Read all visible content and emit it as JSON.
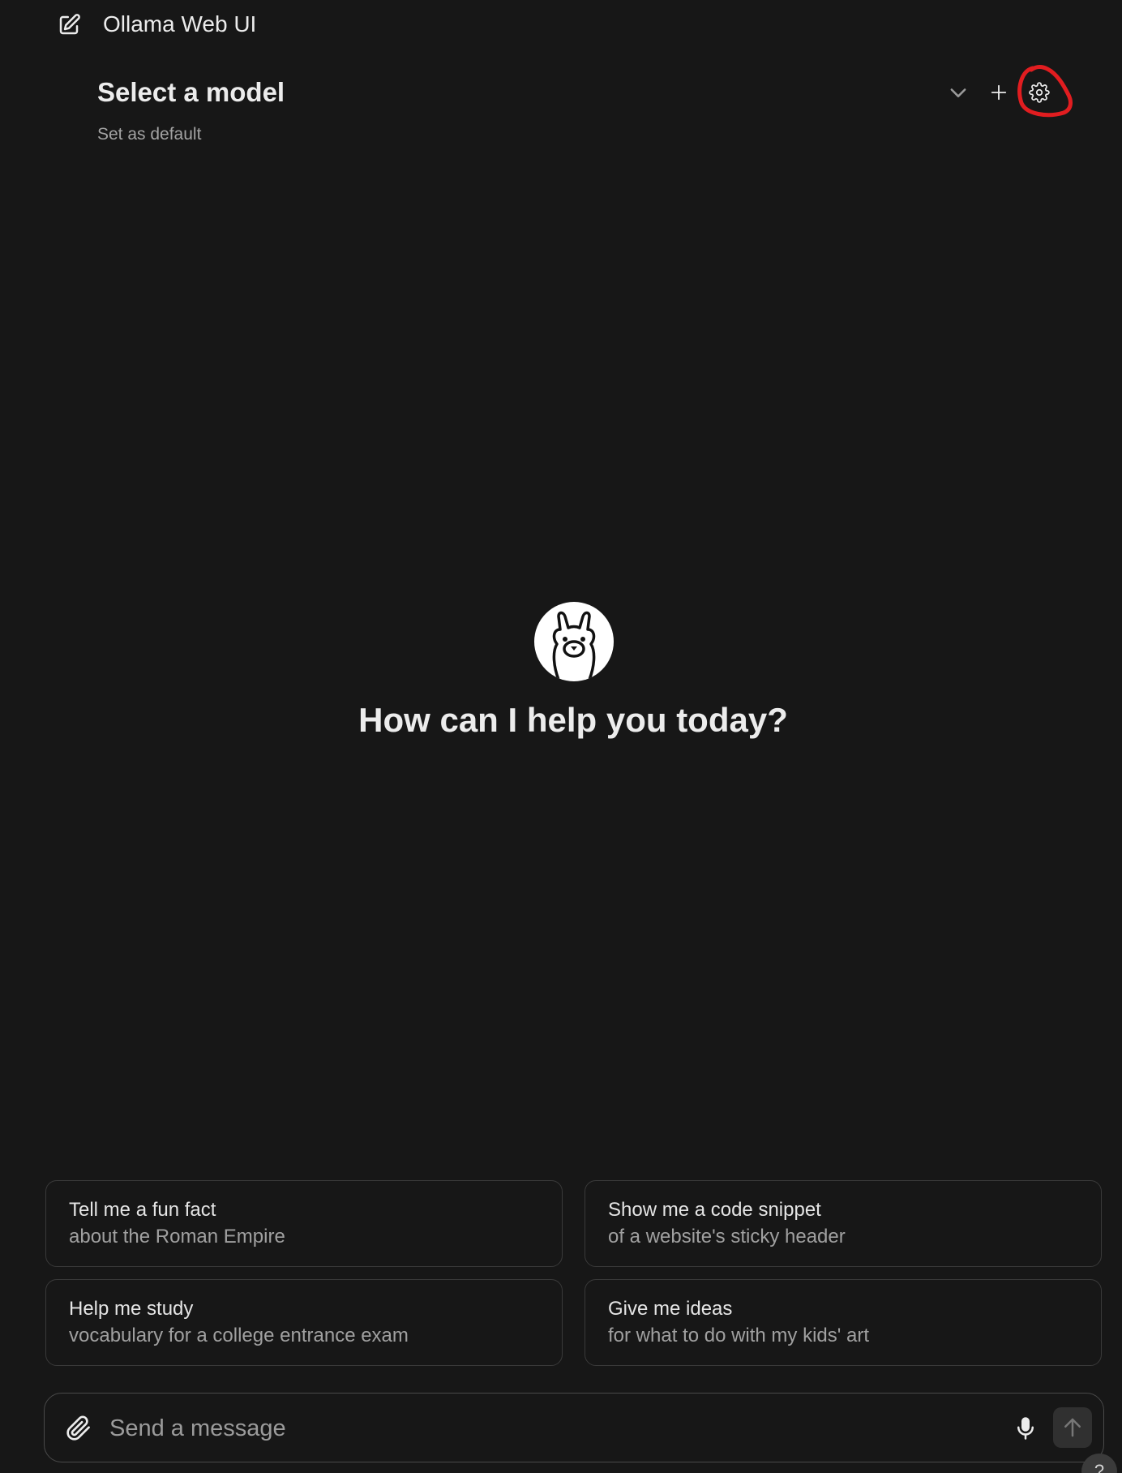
{
  "header": {
    "title": "Ollama Web UI",
    "edit_icon": "edit-icon"
  },
  "model_selector": {
    "title": "Select a model",
    "set_default": "Set as default",
    "chevron_icon": "chevron-down-icon",
    "plus_icon": "plus-icon",
    "settings_icon": "gear-icon"
  },
  "main": {
    "logo_icon": "llama-icon",
    "greeting": "How can I help you today?"
  },
  "suggestions": [
    {
      "title": "Tell me a fun fact",
      "subtitle": "about the Roman Empire"
    },
    {
      "title": "Show me a code snippet",
      "subtitle": "of a website's sticky header"
    },
    {
      "title": "Help me study",
      "subtitle": "vocabulary for a college entrance exam"
    },
    {
      "title": "Give me ideas",
      "subtitle": "for what to do with my kids' art"
    }
  ],
  "input": {
    "placeholder": "Send a message",
    "value": "",
    "attach_icon": "paperclip-icon",
    "mic_icon": "microphone-icon",
    "send_icon": "arrow-up-icon"
  },
  "help": {
    "label": "?"
  },
  "colors": {
    "background": "#171717",
    "text": "#ececec",
    "muted": "#a3a3a3",
    "border": "#3a3a3a",
    "annotation": "#e11d20"
  }
}
